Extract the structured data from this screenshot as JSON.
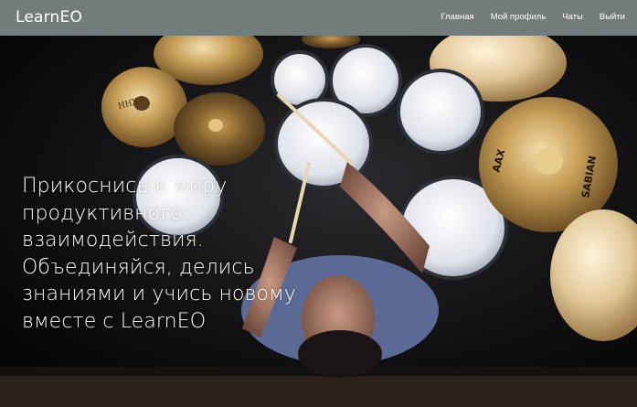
{
  "navbar": {
    "brand": "LearnEO",
    "links": [
      {
        "label": "Главная"
      },
      {
        "label": "Мой профиль"
      },
      {
        "label": "Чаты"
      },
      {
        "label": "Выйти"
      }
    ],
    "background": "#727c7b"
  },
  "hero": {
    "lines": [
      "Прикоснись к миру",
      "продуктивного",
      "взаимодействия.",
      "Объединяйся, делись",
      "знаниями и учись новому",
      "вместе с LearnEO"
    ]
  },
  "image": {
    "cymbal_labels": {
      "left_top": "HHX",
      "right_brand": "SABIAN",
      "right_model": "AAX"
    }
  }
}
